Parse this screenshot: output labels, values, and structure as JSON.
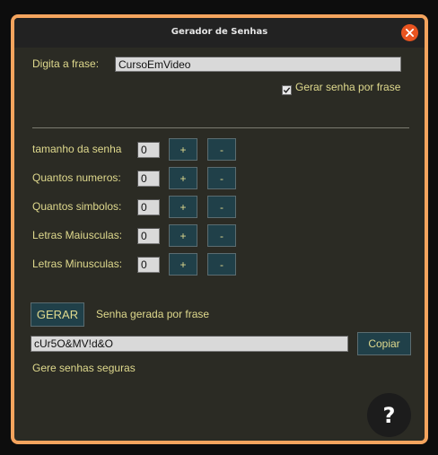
{
  "window": {
    "title": "Gerador de Senhas"
  },
  "phrase": {
    "label": "Digita a frase:",
    "value": "CursoEmVideo"
  },
  "checkbox": {
    "label": "Gerar senha por frase",
    "checked": true
  },
  "rows": [
    {
      "label": "tamanho da senha",
      "value": "0",
      "plus": "+",
      "minus": "-"
    },
    {
      "label": "Quantos numeros:",
      "value": "0",
      "plus": "+",
      "minus": "-"
    },
    {
      "label": "Quantos simbolos:",
      "value": "0",
      "plus": "+",
      "minus": "-"
    },
    {
      "label": "Letras Maiusculas:",
      "value": "0",
      "plus": "+",
      "minus": "-"
    },
    {
      "label": "Letras Minusculas:",
      "value": "0",
      "plus": "+",
      "minus": "-"
    }
  ],
  "generate": {
    "button": "GERAR",
    "status": "Senha gerada por frase"
  },
  "output": {
    "value": "cUr5O&MV!d&O",
    "copy_button": "Copiar"
  },
  "footer": {
    "text": "Gere senhas seguras"
  },
  "help": {
    "label": "?"
  },
  "colors": {
    "accent": "#e95420",
    "frame": "#f4a45e",
    "label": "#dfd98d",
    "button_bg": "#204049",
    "window_bg": "#2b2b24"
  }
}
